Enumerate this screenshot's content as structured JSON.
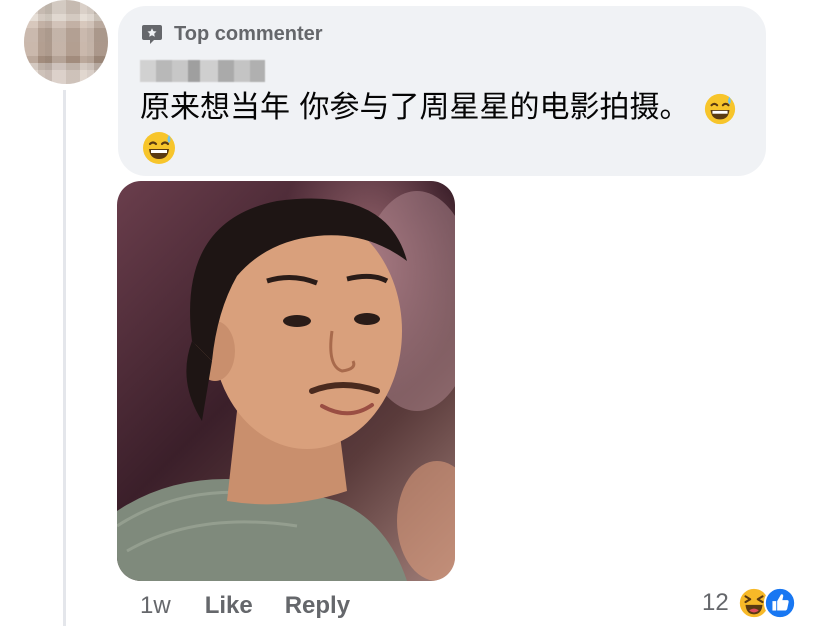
{
  "comment": {
    "badge_label": "Top commenter",
    "text": "原来想当年 你参与了周星星的电影拍摄。",
    "emoji_name": "grinning-sweat-emoji"
  },
  "footer": {
    "time": "1w",
    "like_label": "Like",
    "reply_label": "Reply",
    "reaction_count": "12"
  },
  "colors": {
    "bubble_bg": "#f0f2f5",
    "secondary_text": "#65676b",
    "like_blue": "#1877f2",
    "haha_yellow": "#f7b928"
  },
  "icons": [
    "top-commenter-badge-icon",
    "haha-reaction-icon",
    "like-reaction-icon"
  ]
}
